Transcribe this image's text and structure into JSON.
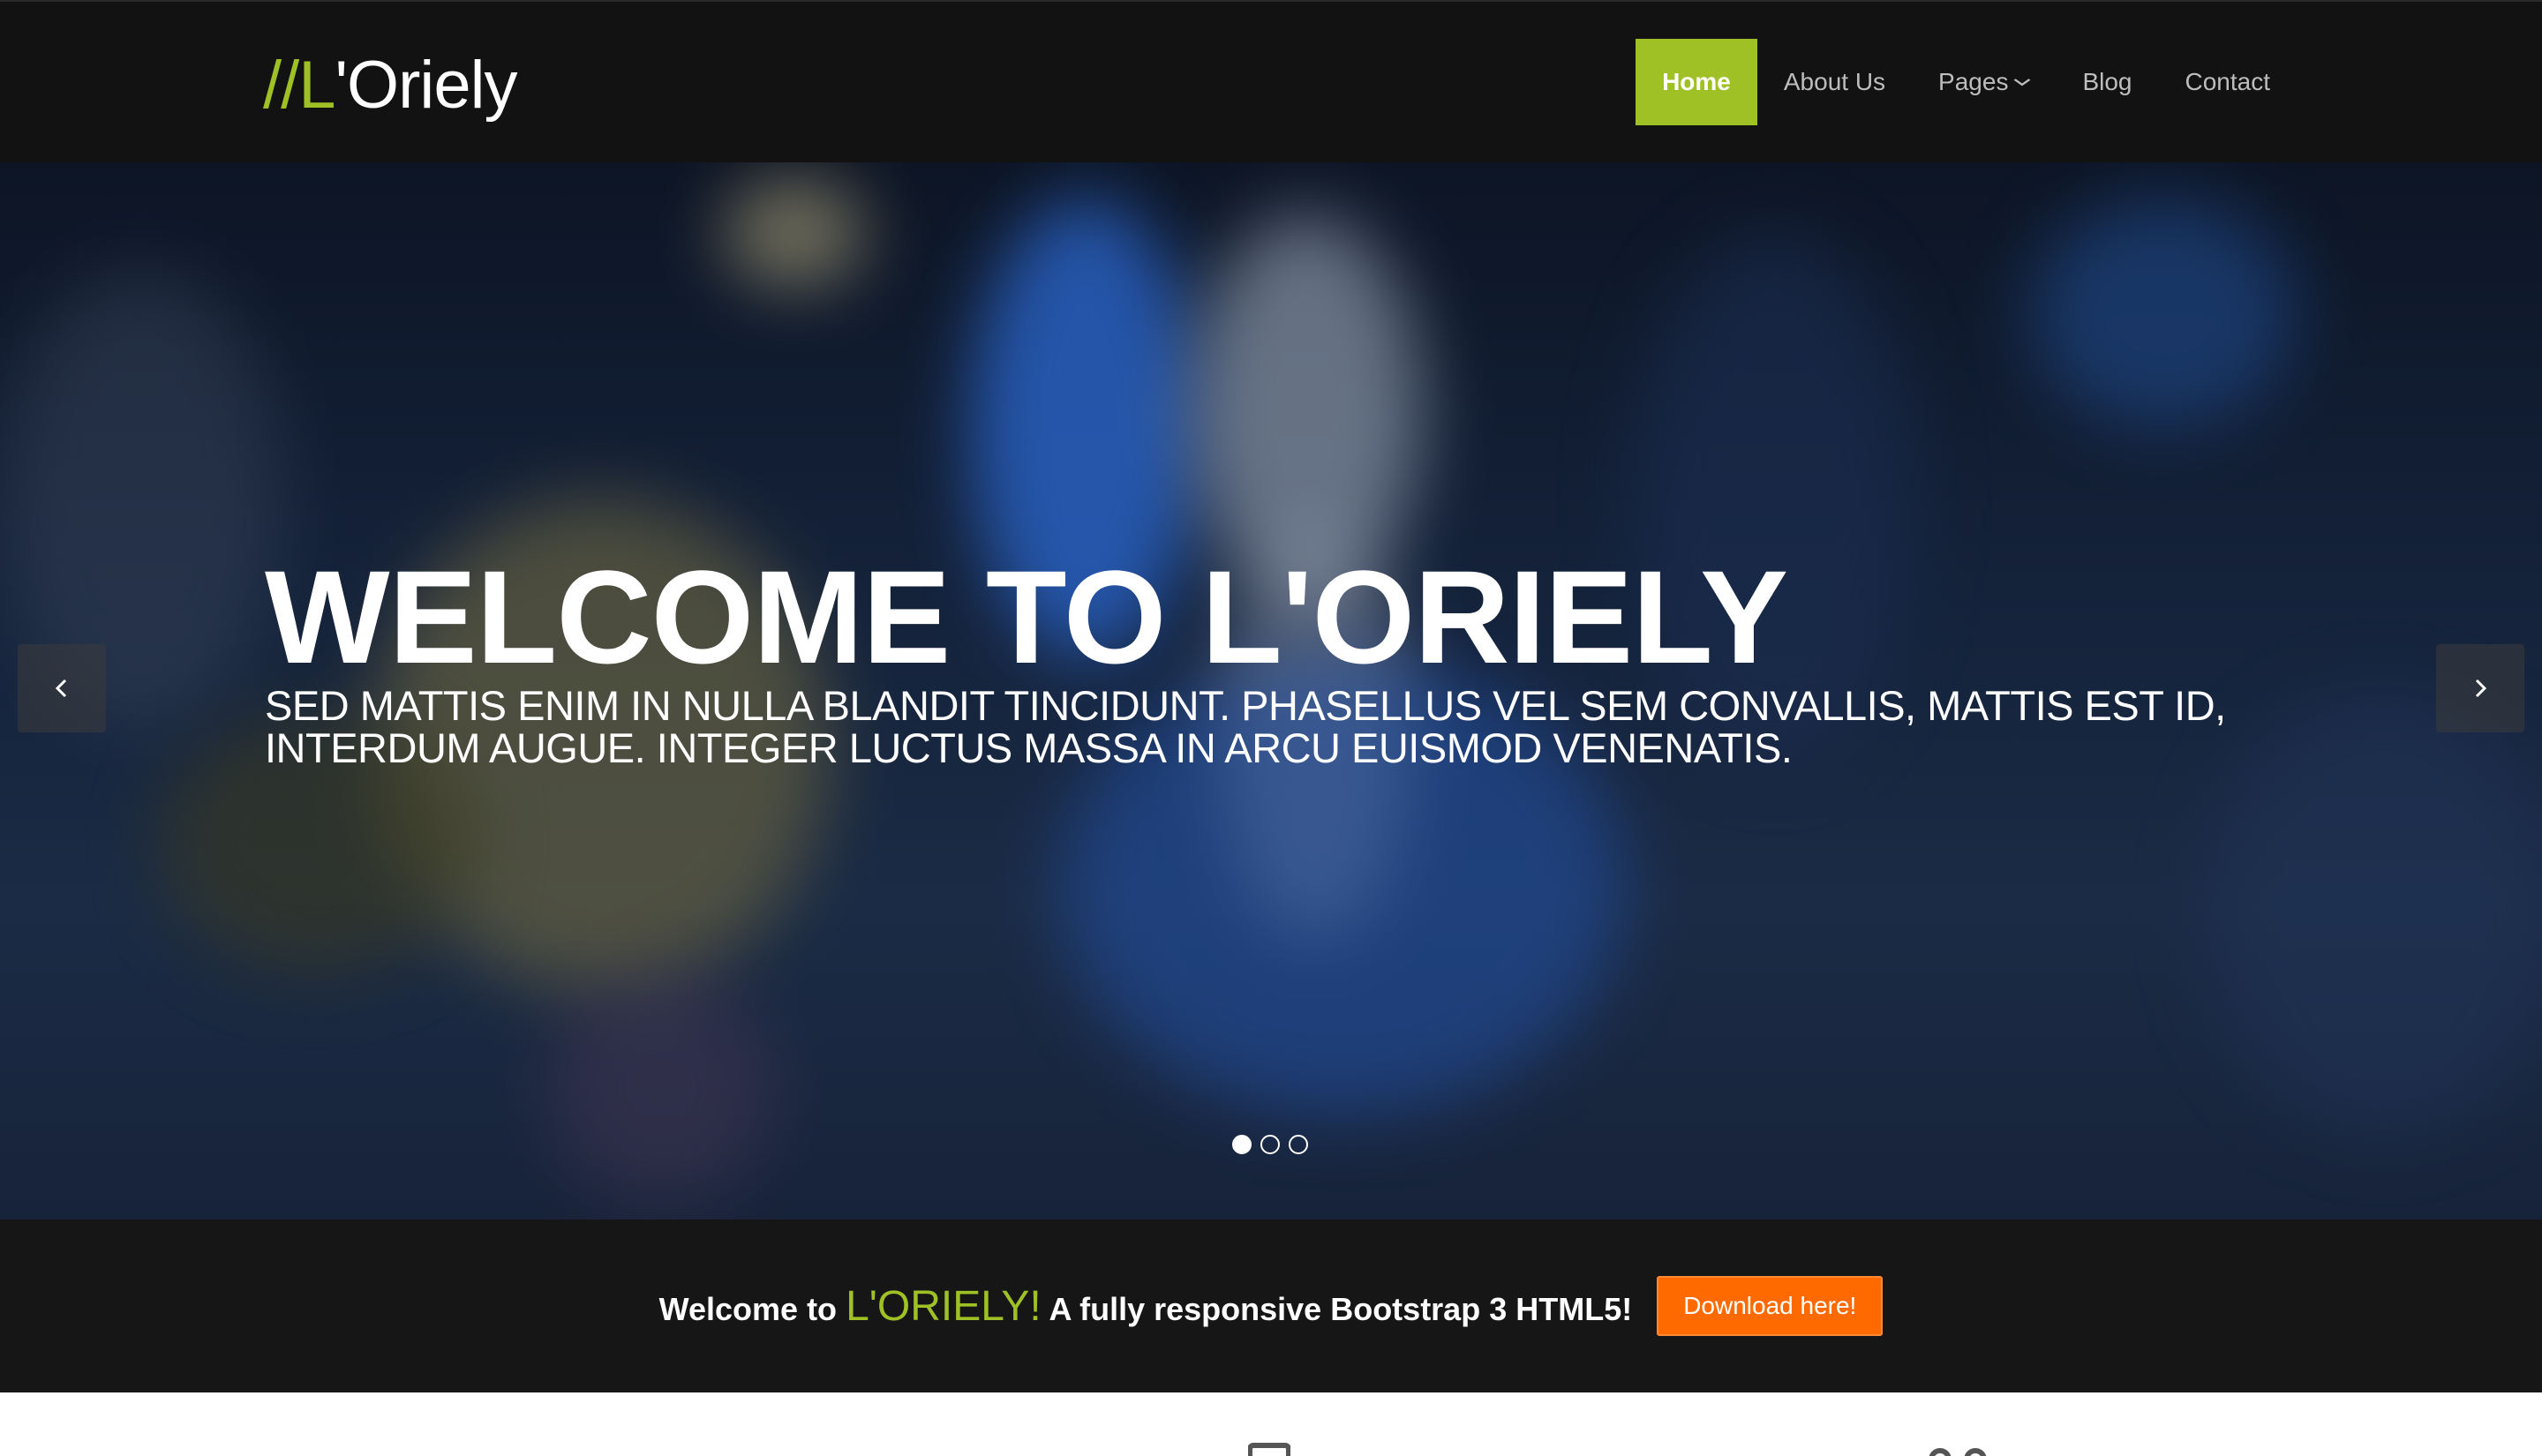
{
  "brand": {
    "slashes": "//L",
    "rest": "'Oriely"
  },
  "nav": {
    "items": [
      {
        "label": "Home",
        "active": true
      },
      {
        "label": "About Us"
      },
      {
        "label": "Pages",
        "dropdown": true
      },
      {
        "label": "Blog"
      },
      {
        "label": "Contact"
      }
    ]
  },
  "hero": {
    "title": "WELCOME TO L'ORIELY",
    "subtitle": "SED MATTIS ENIM IN NULLA BLANDIT TINCIDUNT. PHASELLUS VEL SEM CONVALLIS, MATTIS EST ID, INTERDUM AUGUE. INTEGER LUCTUS MASSA IN ARCU EUISMOD VENENATIS.",
    "slides": 3,
    "active_slide": 1,
    "prev_icon": "chevron-left-icon",
    "next_icon": "chevron-right-icon"
  },
  "cta": {
    "prefix": "Welcome to",
    "brand": "L'ORIELY!",
    "suffix": "A fully responsive Bootstrap 3 HTML5!",
    "button": "Download here!"
  },
  "colors": {
    "accent": "#9fc125",
    "button": "#ff6a00",
    "navbar": "#121212"
  }
}
